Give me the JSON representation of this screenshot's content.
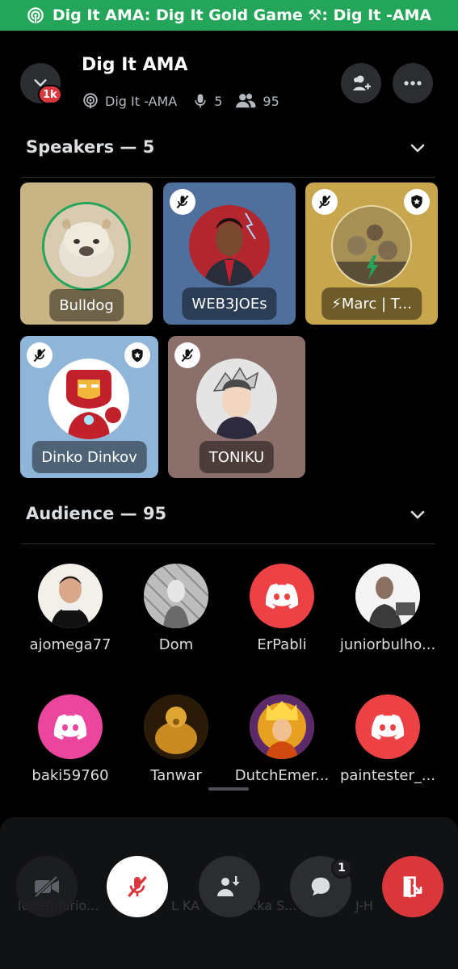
{
  "banner": {
    "text": "Dig It AMA: Dig It Gold Game ⚒: Dig It -AMA",
    "color": "#23a55a"
  },
  "header": {
    "title": "Dig It AMA",
    "badge": "1k",
    "channel": "Dig It -AMA",
    "speaker_count": "5",
    "listener_count": "95"
  },
  "speakers": {
    "heading": "Speakers — 5",
    "tiles": [
      {
        "name": "Bulldog",
        "bg": "#c8b485"
      },
      {
        "name": "WEB3JOEs",
        "bg": "#4f6f9c"
      },
      {
        "name": "⚡Marc | T...",
        "bg": "#c7a64d"
      },
      {
        "name": "Dinko Dinkov",
        "bg": "#8fb6d8"
      },
      {
        "name": "TONIKU",
        "bg": "#8a6f6a"
      }
    ]
  },
  "audience": {
    "heading": "Audience — 95",
    "members": [
      {
        "name": "ajomega77",
        "color": "#3a2a22"
      },
      {
        "name": "Dom",
        "color": "#9a9a9a"
      },
      {
        "name": "ErPabli",
        "color": "#ed4245"
      },
      {
        "name": "juniorbulho...",
        "color": "#cfcfcf"
      },
      {
        "name": "baki59760",
        "color": "#eb459e"
      },
      {
        "name": "Tanwar",
        "color": "#8a5a14"
      },
      {
        "name": "DutchEmer...",
        "color": "#d7a21a"
      },
      {
        "name": "paintester_...",
        "color": "#ed4245"
      }
    ]
  },
  "controls": {
    "chat_badge": "1",
    "ghost_names": [
      "legendario...",
      "L KA",
      "Pekka S...",
      "J-H"
    ]
  }
}
